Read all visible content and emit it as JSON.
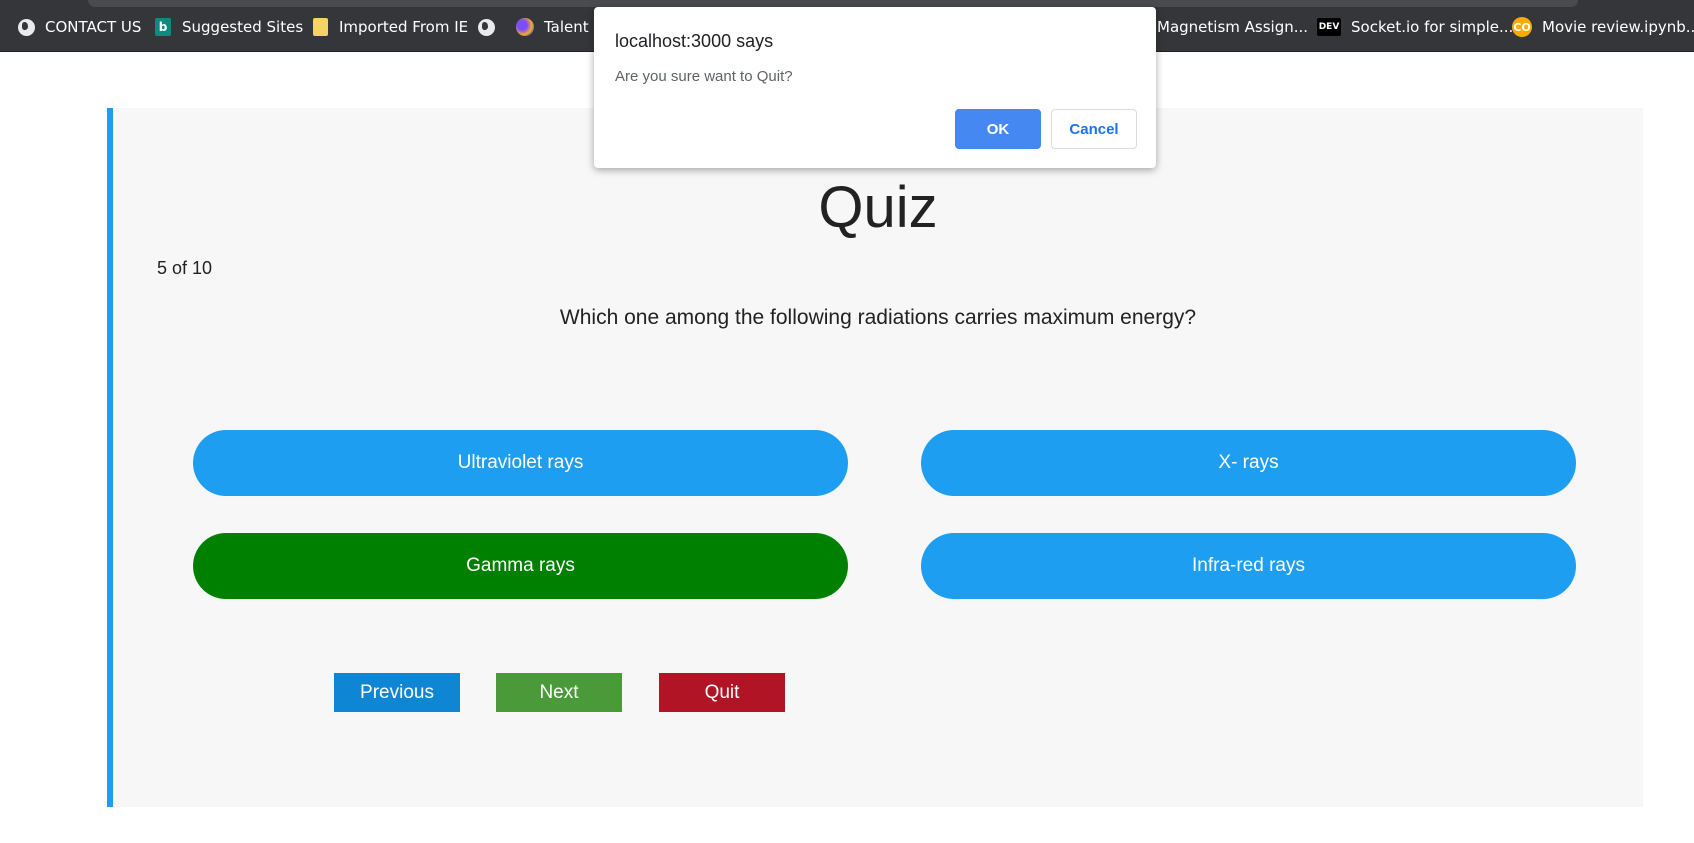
{
  "bookmarks": [
    {
      "label": "CONTACT US",
      "icon": "globe-icon"
    },
    {
      "label": "Suggested Sites",
      "icon": "bing-icon"
    },
    {
      "label": "Imported From IE",
      "icon": "folder-icon"
    },
    {
      "label": "",
      "icon": "globe-icon"
    },
    {
      "label": "Talent E",
      "icon": "talent-icon"
    },
    {
      "label": "Magnetism Assign...",
      "icon": ""
    },
    {
      "label": "Socket.io for simple...",
      "icon": "dev-icon"
    },
    {
      "label": "Movie review.ipynb...",
      "icon": "colab-icon"
    }
  ],
  "icons": {
    "bing_glyph": "b",
    "dev_glyph": "DEV",
    "colab_glyph": "CO"
  },
  "quiz": {
    "title": "Quiz",
    "progress": "5 of 10",
    "question": "Which one among the following radiations carries maximum energy?",
    "options": [
      {
        "label": "Ultraviolet rays",
        "state": "default"
      },
      {
        "label": "X- rays",
        "state": "default"
      },
      {
        "label": "Gamma rays",
        "state": "correct"
      },
      {
        "label": "Infra-red rays",
        "state": "default"
      }
    ],
    "buttons": {
      "previous": "Previous",
      "next": "Next",
      "quit": "Quit"
    }
  },
  "dialog": {
    "title": "localhost:3000 says",
    "message": "Are you sure want to Quit?",
    "ok": "OK",
    "cancel": "Cancel"
  },
  "colors": {
    "accent_blue": "#1e9ef0",
    "correct_green": "#008000",
    "previous_blue": "#0f86d4",
    "next_green": "#4a9a3a",
    "quit_red": "#b11424",
    "dialog_ok": "#4688f1"
  }
}
